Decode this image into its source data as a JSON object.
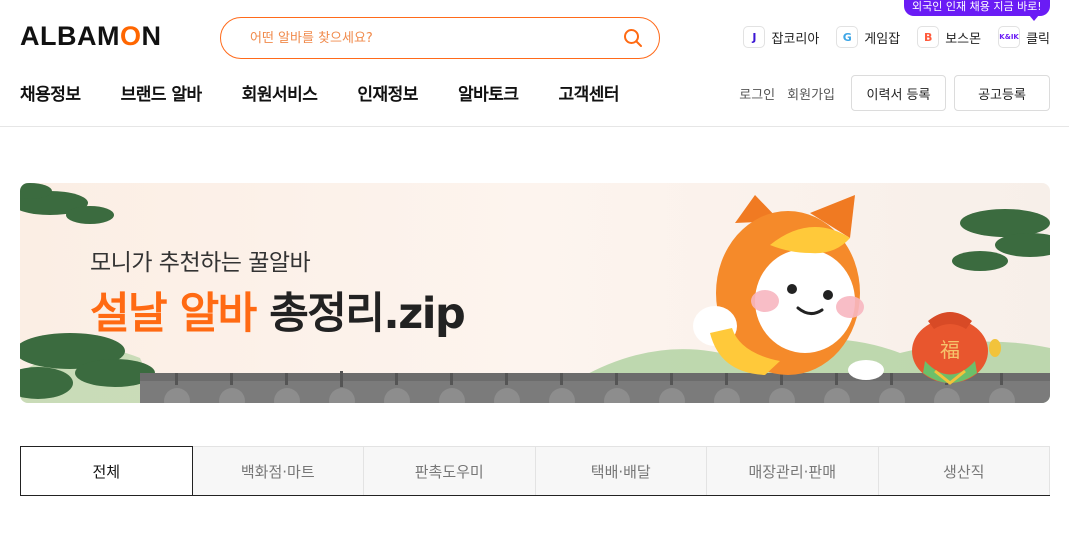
{
  "brand": {
    "logo_text_prefix": "ALBAM",
    "logo_text_o": "O",
    "logo_text_suffix": "N",
    "accent_color": "#ff6a13"
  },
  "search": {
    "placeholder": "어떤 알바를 찾으세요?",
    "value": ""
  },
  "family_sites": [
    {
      "label": "잡코리아",
      "icon": "J",
      "icon_color": "#3b16d4"
    },
    {
      "label": "게임잡",
      "icon": "G",
      "icon_color": "#3da5e6"
    },
    {
      "label": "보스몬",
      "icon": "B",
      "icon_color": "#ff5a3c"
    },
    {
      "label": "클릭",
      "icon": "K&IK",
      "icon_color": "#6a1cf5"
    }
  ],
  "tooltip": {
    "text": "외국인 인재 채용 지금 바로!",
    "color": "#6a1cf5"
  },
  "nav": [
    "채용정보",
    "브랜드 알바",
    "회원서비스",
    "인재정보",
    "알바토크",
    "고객센터"
  ],
  "util": {
    "login": "로그인",
    "signup": "회원가입",
    "resume_button": "이력서 등록",
    "post_button": "공고등록"
  },
  "banner": {
    "subtitle": "모니가 추천하는 꿀알바",
    "headline_highlight": "설날 알바",
    "headline_rest": "총정리.zip",
    "pouch_char": "福"
  },
  "tabs": {
    "items": [
      "전체",
      "백화점·마트",
      "판촉도우미",
      "택배·배달",
      "매장관리·판매",
      "생산직"
    ],
    "active_index": 0
  }
}
